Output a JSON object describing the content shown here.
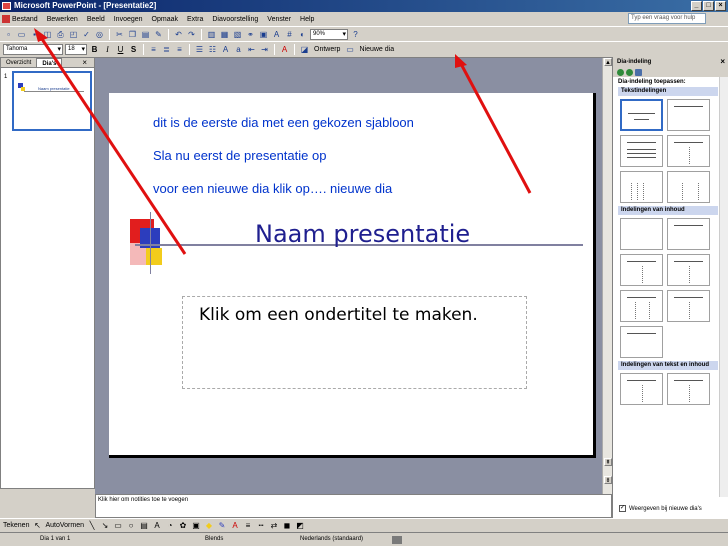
{
  "window": {
    "title": "Microsoft PowerPoint - [Presentatie2]",
    "controls": [
      "_",
      "□",
      "×"
    ]
  },
  "menu": {
    "items": [
      "Bestand",
      "Bewerken",
      "Beeld",
      "Invoegen",
      "Opmaak",
      "Extra",
      "Diavoorstelling",
      "Venster",
      "Help"
    ],
    "help_placeholder": "Typ een vraag voor hulp"
  },
  "toolbar": {
    "font_name": "Tahoma",
    "font_size": "18",
    "zoom": "90%",
    "bold": "B",
    "italic": "I",
    "underline": "U",
    "shadow": "S",
    "design_label": "Ontwerp",
    "new_slide_label": "Nieuwe dia"
  },
  "left_pane": {
    "tabs": [
      "Overzicht",
      "Dia's"
    ],
    "active_tab": "Dia's",
    "slide_number": "1",
    "thumb_title": "Naam presentatie"
  },
  "slide": {
    "instructions": [
      "dit is de eerste dia met een gekozen sjabloon",
      "Sla nu eerst de presentatie op",
      "voor een nieuwe dia klik op…. nieuwe dia"
    ],
    "title": "Naam presentatie",
    "subtitle": "Klik om een ondertitel te maken.",
    "colors": {
      "red": "#e11e1e",
      "blue": "#2c3dbd",
      "yellow": "#f2cc1c",
      "instruction_text": "#0033cc",
      "title_text": "#1f1f8f"
    }
  },
  "notes": {
    "placeholder": "Klik hier om notities toe te voegen"
  },
  "task_pane": {
    "title": "Dia-indeling",
    "apply_label": "Dia-indeling toepassen:",
    "sections": {
      "text": "Tekstindelingen",
      "content": "Indelingen van inhoud",
      "text_content": "Indelingen van tekst en inhoud"
    },
    "show_checkbox_label": "Weergeven bij nieuwe dia's"
  },
  "draw_toolbar": {
    "draw_label": "Tekenen",
    "autoshapes_label": "AutoVormen"
  },
  "status": {
    "slide_of": "Dia 1 van 1",
    "design": "Blends",
    "language": "Nederlands (standaard)"
  }
}
